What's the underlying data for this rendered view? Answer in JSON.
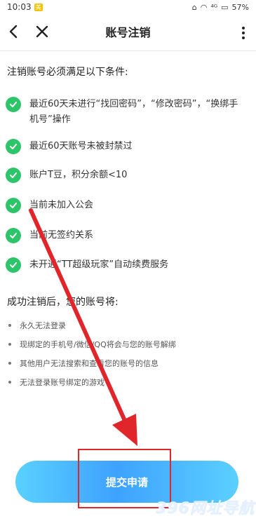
{
  "status_bar": {
    "time": "10:03",
    "badge": "美",
    "signal": "⁴ᴳ",
    "battery": "57%"
  },
  "nav": {
    "title": "账号注销"
  },
  "conditions": {
    "heading": "注销账号必须满足以下条件:",
    "items": [
      "最近60天未进行“找回密码”，“修改密码”，“换绑手机号”操作",
      "最近60天账号未被封禁过",
      "账户T豆，积分余额<10",
      "当前未加入公会",
      "当前无签约关系",
      "未开通“TT超级玩家”自动续费服务"
    ]
  },
  "after": {
    "heading": "成功注销后，您的账号将:",
    "items": [
      "永久无法登录",
      "现绑定的手机号/微信/QQ将会与您的账号解绑",
      "其他用户无法搜索和查看您的账号的信息",
      "无法登录账号绑定的游戏"
    ]
  },
  "submit_label": "提交申请",
  "watermark": "396网址导航",
  "colors": {
    "check": "#2ec46a",
    "button_start": "#5ad1ff",
    "button_mid": "#3ea2ff",
    "annotation": "#e0262b"
  }
}
